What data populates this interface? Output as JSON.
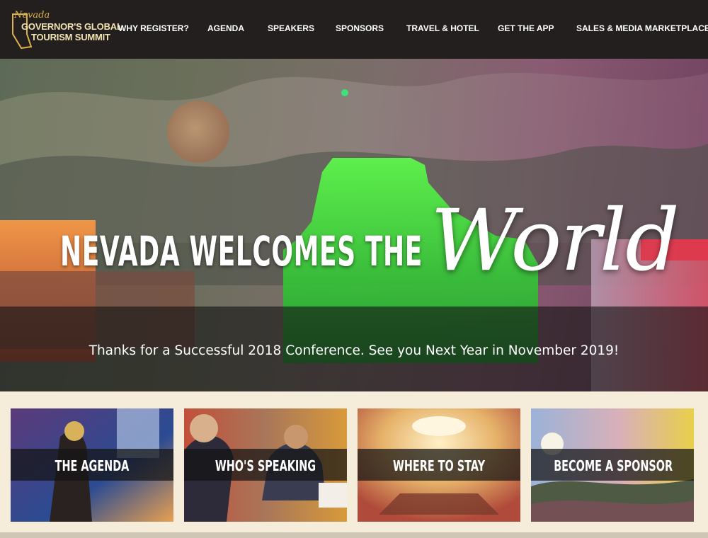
{
  "header": {
    "logo": {
      "script": "Nevada",
      "line1": "GOVERNOR'S GLOBAL",
      "line2": "TOURISM SUMMIT"
    },
    "nav": [
      {
        "label": "WHY REGISTER?"
      },
      {
        "label": "AGENDA"
      },
      {
        "label": "SPEAKERS"
      },
      {
        "label": "SPONSORS"
      },
      {
        "label": "TRAVEL & HOTEL"
      },
      {
        "label": "GET THE APP"
      },
      {
        "label": "SALES & MEDIA MARKETPLACES"
      }
    ]
  },
  "hero": {
    "title": "NEVADA WELCOMES THE",
    "script": "World",
    "tagline": "Thanks for a Successful 2018 Conference. See you Next Year in November 2019!"
  },
  "cards": [
    {
      "label": "THE AGENDA"
    },
    {
      "label": "WHO'S SPEAKING"
    },
    {
      "label": "WHERE TO STAY"
    },
    {
      "label": "BECOME A SPONSOR"
    }
  ],
  "colors": {
    "header_bg": "#231f1e",
    "page_bg": "#f5ecd9",
    "logo_gold": "#d9b34a",
    "neon_green": "#2fdc3a"
  }
}
